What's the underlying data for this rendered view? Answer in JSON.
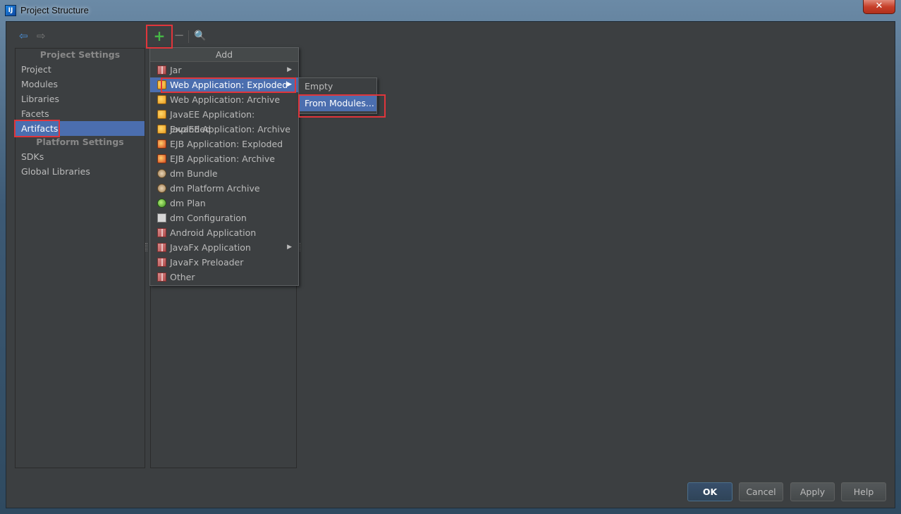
{
  "window": {
    "title": "Project Structure",
    "close_glyph": "✕",
    "icon_text": "IJ"
  },
  "toolbar": {
    "back_glyph": "⇦",
    "forward_glyph": "⇨",
    "add_glyph": "+",
    "remove_glyph": "−",
    "search_glyph": "🔍"
  },
  "left_panel": {
    "project_settings_title": "Project Settings",
    "project_items": [
      "Project",
      "Modules",
      "Libraries",
      "Facets",
      "Artifacts"
    ],
    "platform_settings_title": "Platform Settings",
    "platform_items": [
      "SDKs",
      "Global Libraries"
    ],
    "selected": "Artifacts"
  },
  "add_menu": {
    "title": "Add",
    "items": [
      {
        "label": "Jar",
        "icon": "box-icon",
        "submenu": true
      },
      {
        "label": "Web Application: Exploded",
        "icon": "web-app-icon",
        "submenu": true,
        "selected": true
      },
      {
        "label": "Web Application: Archive",
        "icon": "web-app-icon"
      },
      {
        "label": "JavaEE Application: Exploded",
        "icon": "javaee-icon"
      },
      {
        "label": "JavaEE Application: Archive",
        "icon": "javaee-icon"
      },
      {
        "label": "EJB Application: Exploded",
        "icon": "ejb-icon"
      },
      {
        "label": "EJB Application: Archive",
        "icon": "ejb-icon"
      },
      {
        "label": "dm Bundle",
        "icon": "dm-bundle-icon"
      },
      {
        "label": "dm Platform Archive",
        "icon": "dm-archive-icon"
      },
      {
        "label": "dm Plan",
        "icon": "globe-icon"
      },
      {
        "label": "dm Configuration",
        "icon": "document-icon"
      },
      {
        "label": "Android Application",
        "icon": "box-icon"
      },
      {
        "label": "JavaFx Application",
        "icon": "box-icon",
        "submenu": true
      },
      {
        "label": "JavaFx Preloader",
        "icon": "box-icon"
      },
      {
        "label": "Other",
        "icon": "box-icon"
      }
    ]
  },
  "submenu": {
    "items": [
      {
        "label": "Empty"
      },
      {
        "label": "From Modules...",
        "selected": true
      }
    ]
  },
  "buttons": {
    "ok": "OK",
    "cancel": "Cancel",
    "apply": "Apply",
    "help": "Help"
  },
  "colors": {
    "selection": "#4b6eaf",
    "highlight_border": "#e0353b",
    "background": "#3c3f41",
    "add_green": "#46b946"
  }
}
